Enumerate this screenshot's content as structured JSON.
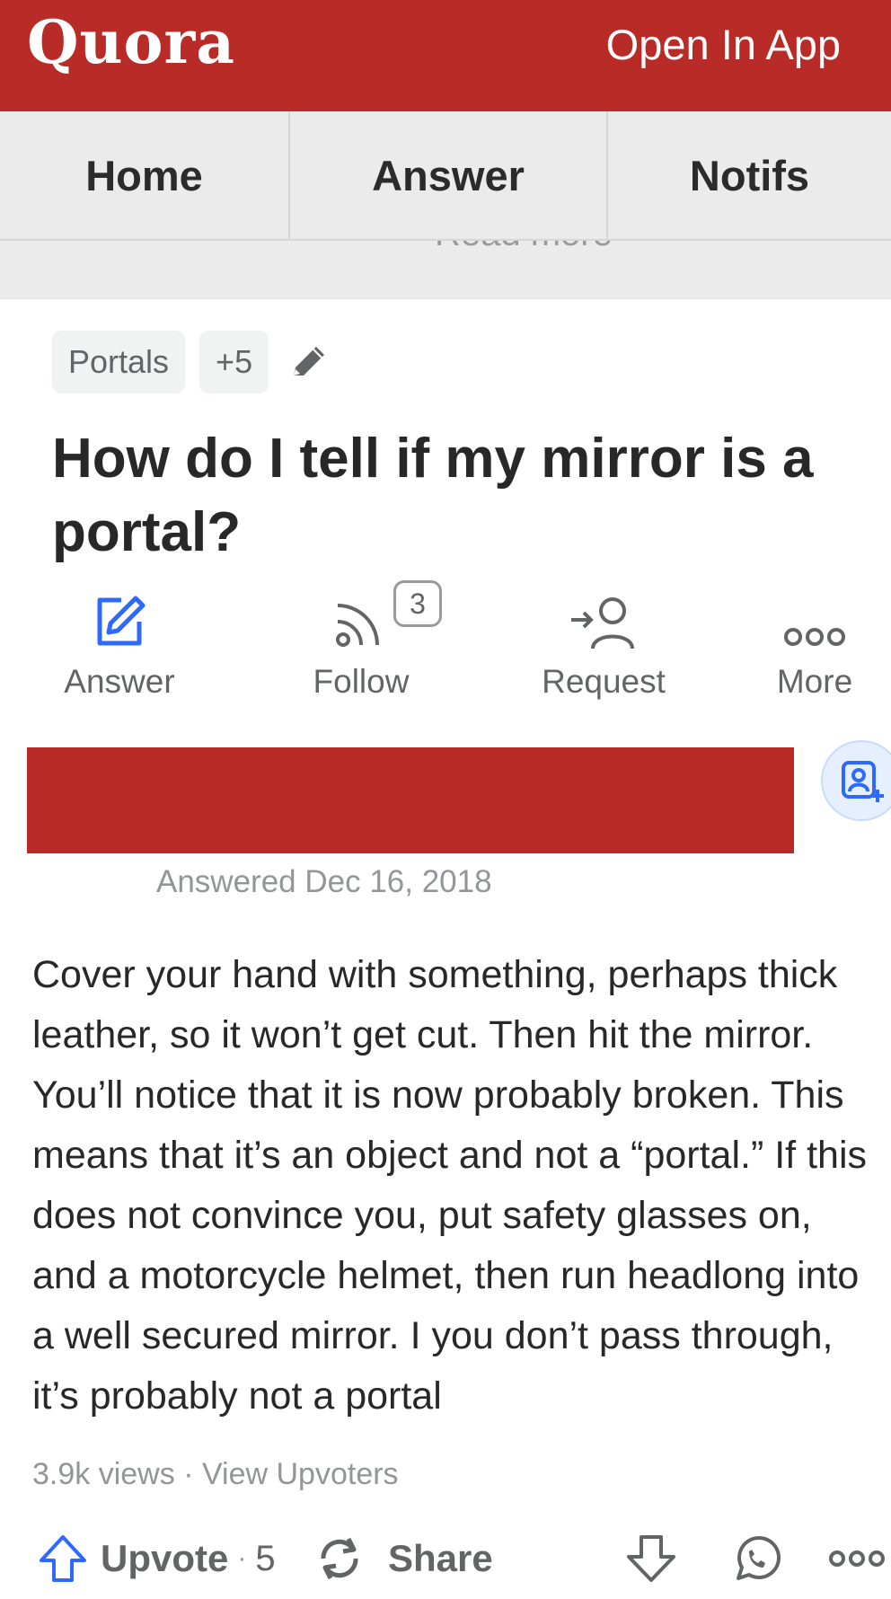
{
  "header": {
    "logo": "Quora",
    "open_in_app": "Open In App"
  },
  "nav": {
    "tabs": [
      {
        "label": "Home"
      },
      {
        "label": "Answer"
      },
      {
        "label": "Notifs"
      }
    ]
  },
  "partial_strip_text": "Read more",
  "topics": {
    "items": [
      "Portals",
      "+5"
    ]
  },
  "question": {
    "title": "How do I tell if my mirror is a portal?"
  },
  "question_actions": {
    "answer_label": "Answer",
    "follow_label": "Follow",
    "follow_count": "3",
    "request_label": "Request",
    "more_label": "More"
  },
  "answer": {
    "answered_date": "Answered Dec 16, 2018",
    "text": "Cover your hand with something, perhaps thick leather, so it won’t get cut. Then hit the mirror. You’ll notice that it is now probably broken. This means that it’s an object and not a “portal.” If this does not convince you, put safety glasses on, and a motorcycle helmet, then run headlong into a well secured mirror. I you don’t pass through, it’s probably not a portal",
    "views": "3.9k views",
    "separator": "·",
    "view_upvoters": "View Upvoters"
  },
  "answer_actions": {
    "upvote_label": "Upvote",
    "upvote_count": "5",
    "share_label": "Share"
  },
  "colors": {
    "brand": "#b92b27",
    "accent_blue": "#2e69ff",
    "muted": "#939598"
  }
}
